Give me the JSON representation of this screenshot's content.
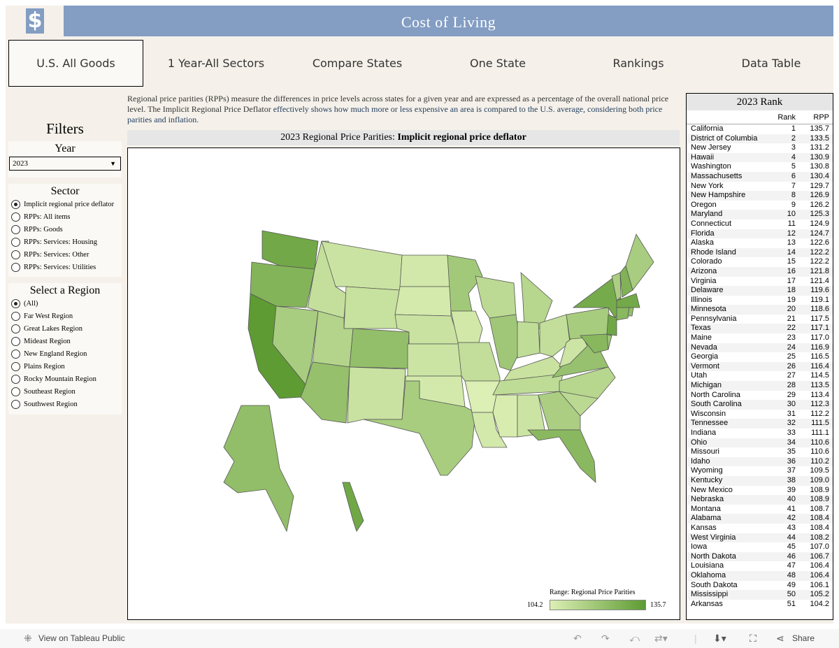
{
  "header": {
    "logo_icon": "dollar-icon",
    "logo_glyph": "$",
    "title": "Cost of Living"
  },
  "tabs": [
    "U.S. All Goods",
    "1 Year-All Sectors",
    "Compare States",
    "One State",
    "Rankings",
    "Data Table"
  ],
  "filters": {
    "title": "Filters",
    "year": {
      "label": "Year",
      "value": "2023"
    },
    "sector": {
      "label": "Sector",
      "selected": 0,
      "options": [
        "Implicit regional price deflator",
        "RPPs: All items",
        "RPPs: Goods",
        "RPPs: Services: Housing",
        "RPPs: Services: Other",
        "RPPs: Services: Utilities"
      ]
    },
    "region": {
      "label": "Select a Region",
      "selected": 0,
      "options": [
        "(All)",
        "Far West Region",
        "Great Lakes Region",
        "Mideast Region",
        "New England Region",
        "Plains Region",
        "Rocky Mountain Region",
        "Southeast Region",
        "Southwest Region"
      ]
    }
  },
  "description": {
    "part1": "Regional price parities (RPPs) measure the differences in price levels across states for a given year and are expressed as a percentage of the overall national price level. The Implicit Regional Price Deflator ",
    "part2": "effectively shows how much more or less expensive an area is compared to the U.S. average, considering both price parities and inflation."
  },
  "map": {
    "title_prefix": "2023 Regional Price Parities: ",
    "title_bold": "Implicit regional price deflator",
    "legend_title": "Range: Regional Price Parities",
    "min": 104.2,
    "max": 135.7,
    "min_label": "104.2",
    "max_label": "135.7",
    "color_low": "#dcefb4",
    "color_high": "#5e9b33"
  },
  "rank": {
    "title": "2023 Rank",
    "col_rank": "Rank",
    "col_rpp": "RPP",
    "rows": [
      [
        "California",
        "1",
        "135.7"
      ],
      [
        "District of Columbia",
        "2",
        "133.5"
      ],
      [
        "New Jersey",
        "3",
        "131.2"
      ],
      [
        "Hawaii",
        "4",
        "130.9"
      ],
      [
        "Washington",
        "5",
        "130.8"
      ],
      [
        "Massachusetts",
        "6",
        "130.4"
      ],
      [
        "New York",
        "7",
        "129.7"
      ],
      [
        "New Hampshire",
        "8",
        "126.9"
      ],
      [
        "Oregon",
        "9",
        "126.2"
      ],
      [
        "Maryland",
        "10",
        "125.3"
      ],
      [
        "Connecticut",
        "11",
        "124.9"
      ],
      [
        "Florida",
        "12",
        "124.7"
      ],
      [
        "Alaska",
        "13",
        "122.6"
      ],
      [
        "Rhode Island",
        "14",
        "122.2"
      ],
      [
        "Colorado",
        "15",
        "122.2"
      ],
      [
        "Arizona",
        "16",
        "121.8"
      ],
      [
        "Virginia",
        "17",
        "121.4"
      ],
      [
        "Delaware",
        "18",
        "119.6"
      ],
      [
        "Illinois",
        "19",
        "119.1"
      ],
      [
        "Minnesota",
        "20",
        "118.6"
      ],
      [
        "Pennsylvania",
        "21",
        "117.5"
      ],
      [
        "Texas",
        "22",
        "117.1"
      ],
      [
        "Maine",
        "23",
        "117.0"
      ],
      [
        "Nevada",
        "24",
        "116.9"
      ],
      [
        "Georgia",
        "25",
        "116.5"
      ],
      [
        "Vermont",
        "26",
        "116.4"
      ],
      [
        "Utah",
        "27",
        "114.5"
      ],
      [
        "Michigan",
        "28",
        "113.5"
      ],
      [
        "North Carolina",
        "29",
        "113.4"
      ],
      [
        "South Carolina",
        "30",
        "112.3"
      ],
      [
        "Wisconsin",
        "31",
        "112.2"
      ],
      [
        "Tennessee",
        "32",
        "111.5"
      ],
      [
        "Indiana",
        "33",
        "111.1"
      ],
      [
        "Ohio",
        "34",
        "110.6"
      ],
      [
        "Missouri",
        "35",
        "110.6"
      ],
      [
        "Idaho",
        "36",
        "110.2"
      ],
      [
        "Wyoming",
        "37",
        "109.5"
      ],
      [
        "Kentucky",
        "38",
        "109.0"
      ],
      [
        "New Mexico",
        "39",
        "108.9"
      ],
      [
        "Nebraska",
        "40",
        "108.9"
      ],
      [
        "Montana",
        "41",
        "108.7"
      ],
      [
        "Alabama",
        "42",
        "108.4"
      ],
      [
        "Kansas",
        "43",
        "108.4"
      ],
      [
        "West Virginia",
        "44",
        "108.2"
      ],
      [
        "Iowa",
        "45",
        "107.0"
      ],
      [
        "North Dakota",
        "46",
        "106.7"
      ],
      [
        "Louisiana",
        "47",
        "106.4"
      ],
      [
        "Oklahoma",
        "48",
        "106.4"
      ],
      [
        "South Dakota",
        "49",
        "106.1"
      ],
      [
        "Mississippi",
        "50",
        "105.2"
      ],
      [
        "Arkansas",
        "51",
        "104.2"
      ]
    ]
  },
  "footer": {
    "view_label": "View on Tableau Public",
    "share_label": "Share"
  }
}
